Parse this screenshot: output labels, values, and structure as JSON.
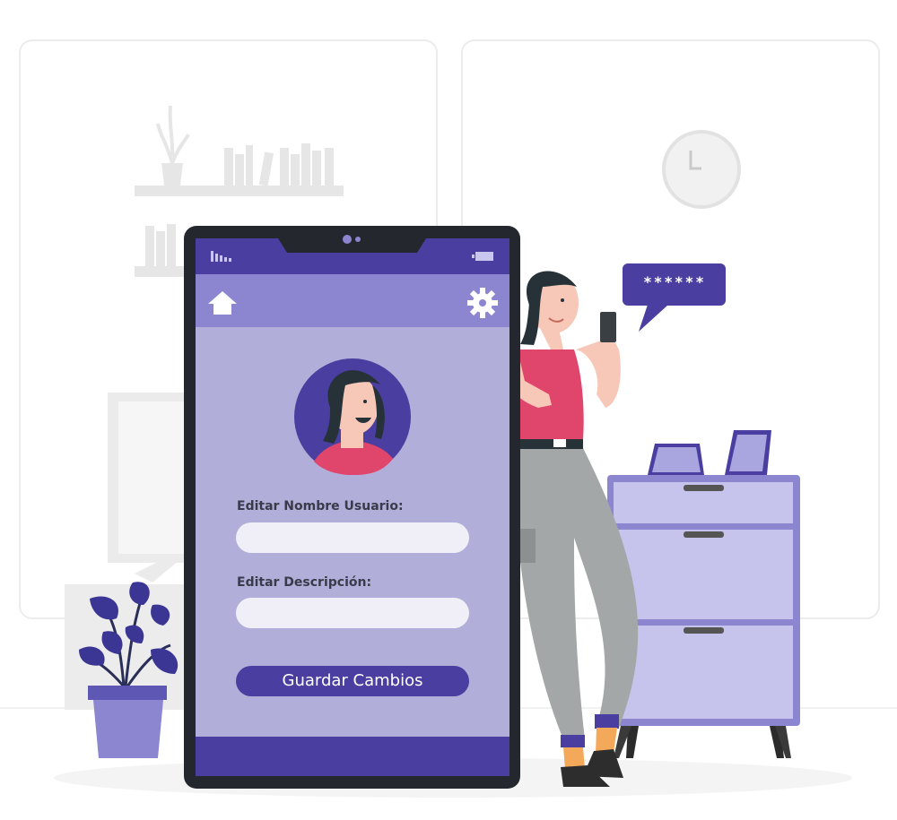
{
  "profile_form": {
    "username_label": "Editar Nombre Usuario:",
    "username_value": "",
    "description_label": "Editar Descripción:",
    "description_value": "",
    "save_label": "Guardar Cambios"
  },
  "speech_bubble": {
    "text": "******"
  },
  "colors": {
    "primary": "#4a3fa0",
    "header": "#8c86d0",
    "screen": "#b1afd9",
    "phone_frame": "#24282e",
    "accent_pink": "#e0456b",
    "dresser": "#c6c3ec"
  },
  "icons": {
    "home": "home-icon",
    "settings": "gear-icon",
    "signal": "signal-icon",
    "battery": "battery-icon"
  }
}
